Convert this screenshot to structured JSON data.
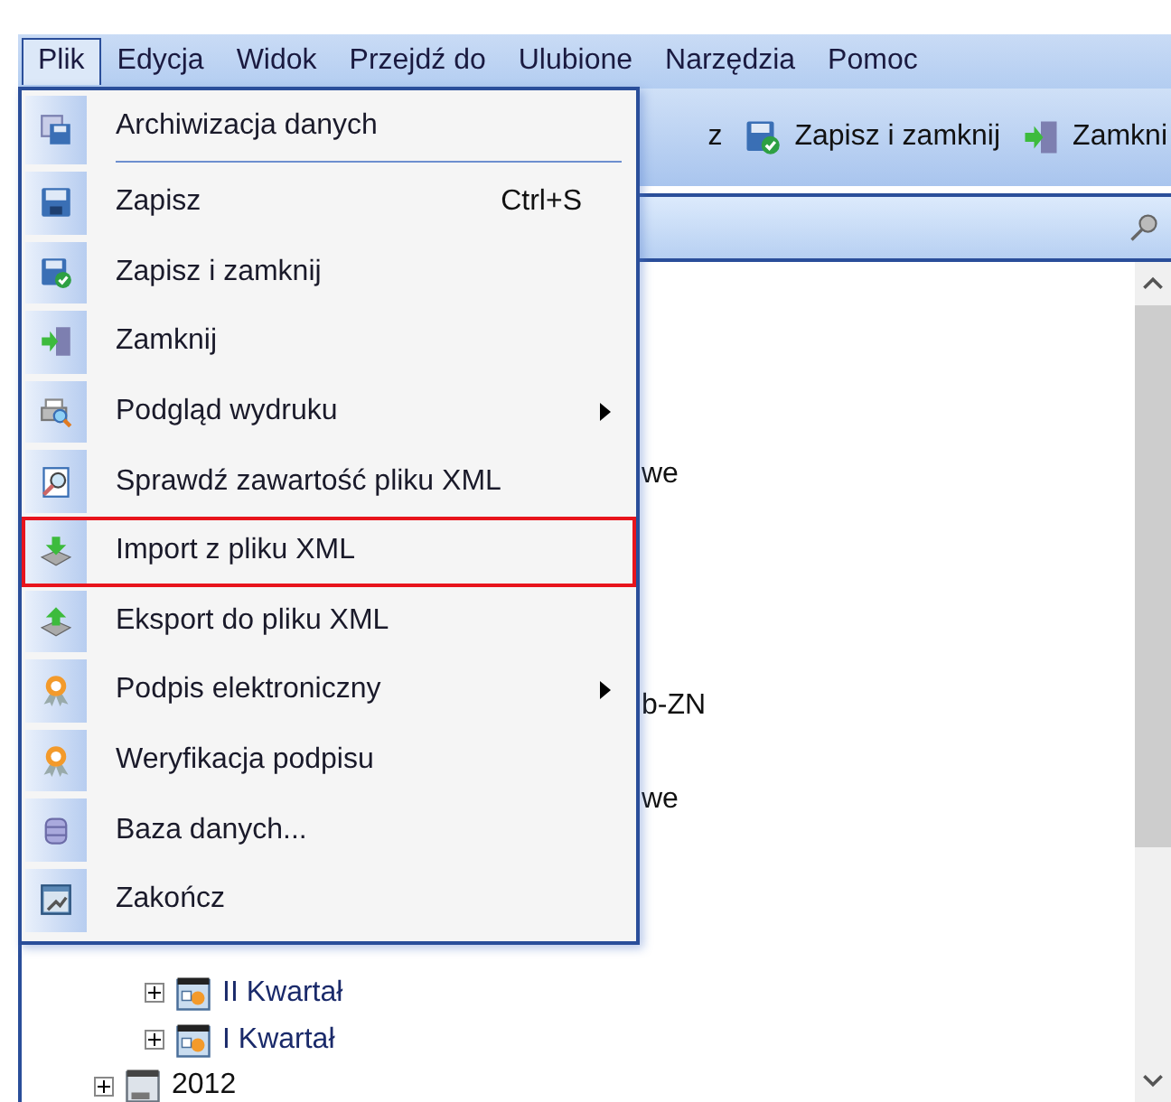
{
  "menu_bar": [
    {
      "label": "Plik",
      "selected": true
    },
    {
      "label": "Edycja",
      "selected": false
    },
    {
      "label": "Widok",
      "selected": false
    },
    {
      "label": "Przejdź do",
      "selected": false
    },
    {
      "label": "Ulubione",
      "selected": false
    },
    {
      "label": "Narzędzia",
      "selected": false
    },
    {
      "label": "Pomoc",
      "selected": false
    }
  ],
  "toolbar": [
    {
      "label": "z"
    },
    {
      "label": "Zapisz i zamknij"
    },
    {
      "label": "Zamkni"
    }
  ],
  "dropdown": {
    "items": [
      {
        "label": "Archiwizacja danych",
        "separator_after": true,
        "has_submenu": false,
        "highlighted": false
      },
      {
        "label": "Zapisz",
        "shortcut": "Ctrl+S",
        "separator_after": false,
        "has_submenu": false,
        "highlighted": false
      },
      {
        "label": "Zapisz i zamknij",
        "separator_after": false,
        "has_submenu": false,
        "highlighted": false
      },
      {
        "label": "Zamknij",
        "separator_after": false,
        "has_submenu": false,
        "highlighted": false
      },
      {
        "label": "Podgląd wydruku",
        "separator_after": false,
        "has_submenu": true,
        "highlighted": false
      },
      {
        "label": "Sprawdź zawartość pliku XML",
        "separator_after": false,
        "has_submenu": false,
        "highlighted": false
      },
      {
        "label": "Import z pliku XML",
        "separator_after": false,
        "has_submenu": false,
        "highlighted": true
      },
      {
        "label": "Eksport do pliku XML",
        "separator_after": false,
        "has_submenu": false,
        "highlighted": false
      },
      {
        "label": "Podpis elektroniczny",
        "separator_after": false,
        "has_submenu": true,
        "highlighted": false
      },
      {
        "label": "Weryfikacja podpisu",
        "separator_after": false,
        "has_submenu": false,
        "highlighted": false
      },
      {
        "label": "Baza danych...",
        "separator_after": false,
        "has_submenu": false,
        "highlighted": false
      },
      {
        "label": "Zakończ",
        "separator_after": false,
        "has_submenu": false,
        "highlighted": false
      }
    ]
  },
  "tree_fragments": [
    "we",
    "b-ZN",
    "we"
  ],
  "tree": [
    {
      "label": "II Kwartał",
      "kind": "quarter"
    },
    {
      "label": "I Kwartał",
      "kind": "quarter"
    },
    {
      "label": "2012",
      "kind": "year"
    }
  ]
}
